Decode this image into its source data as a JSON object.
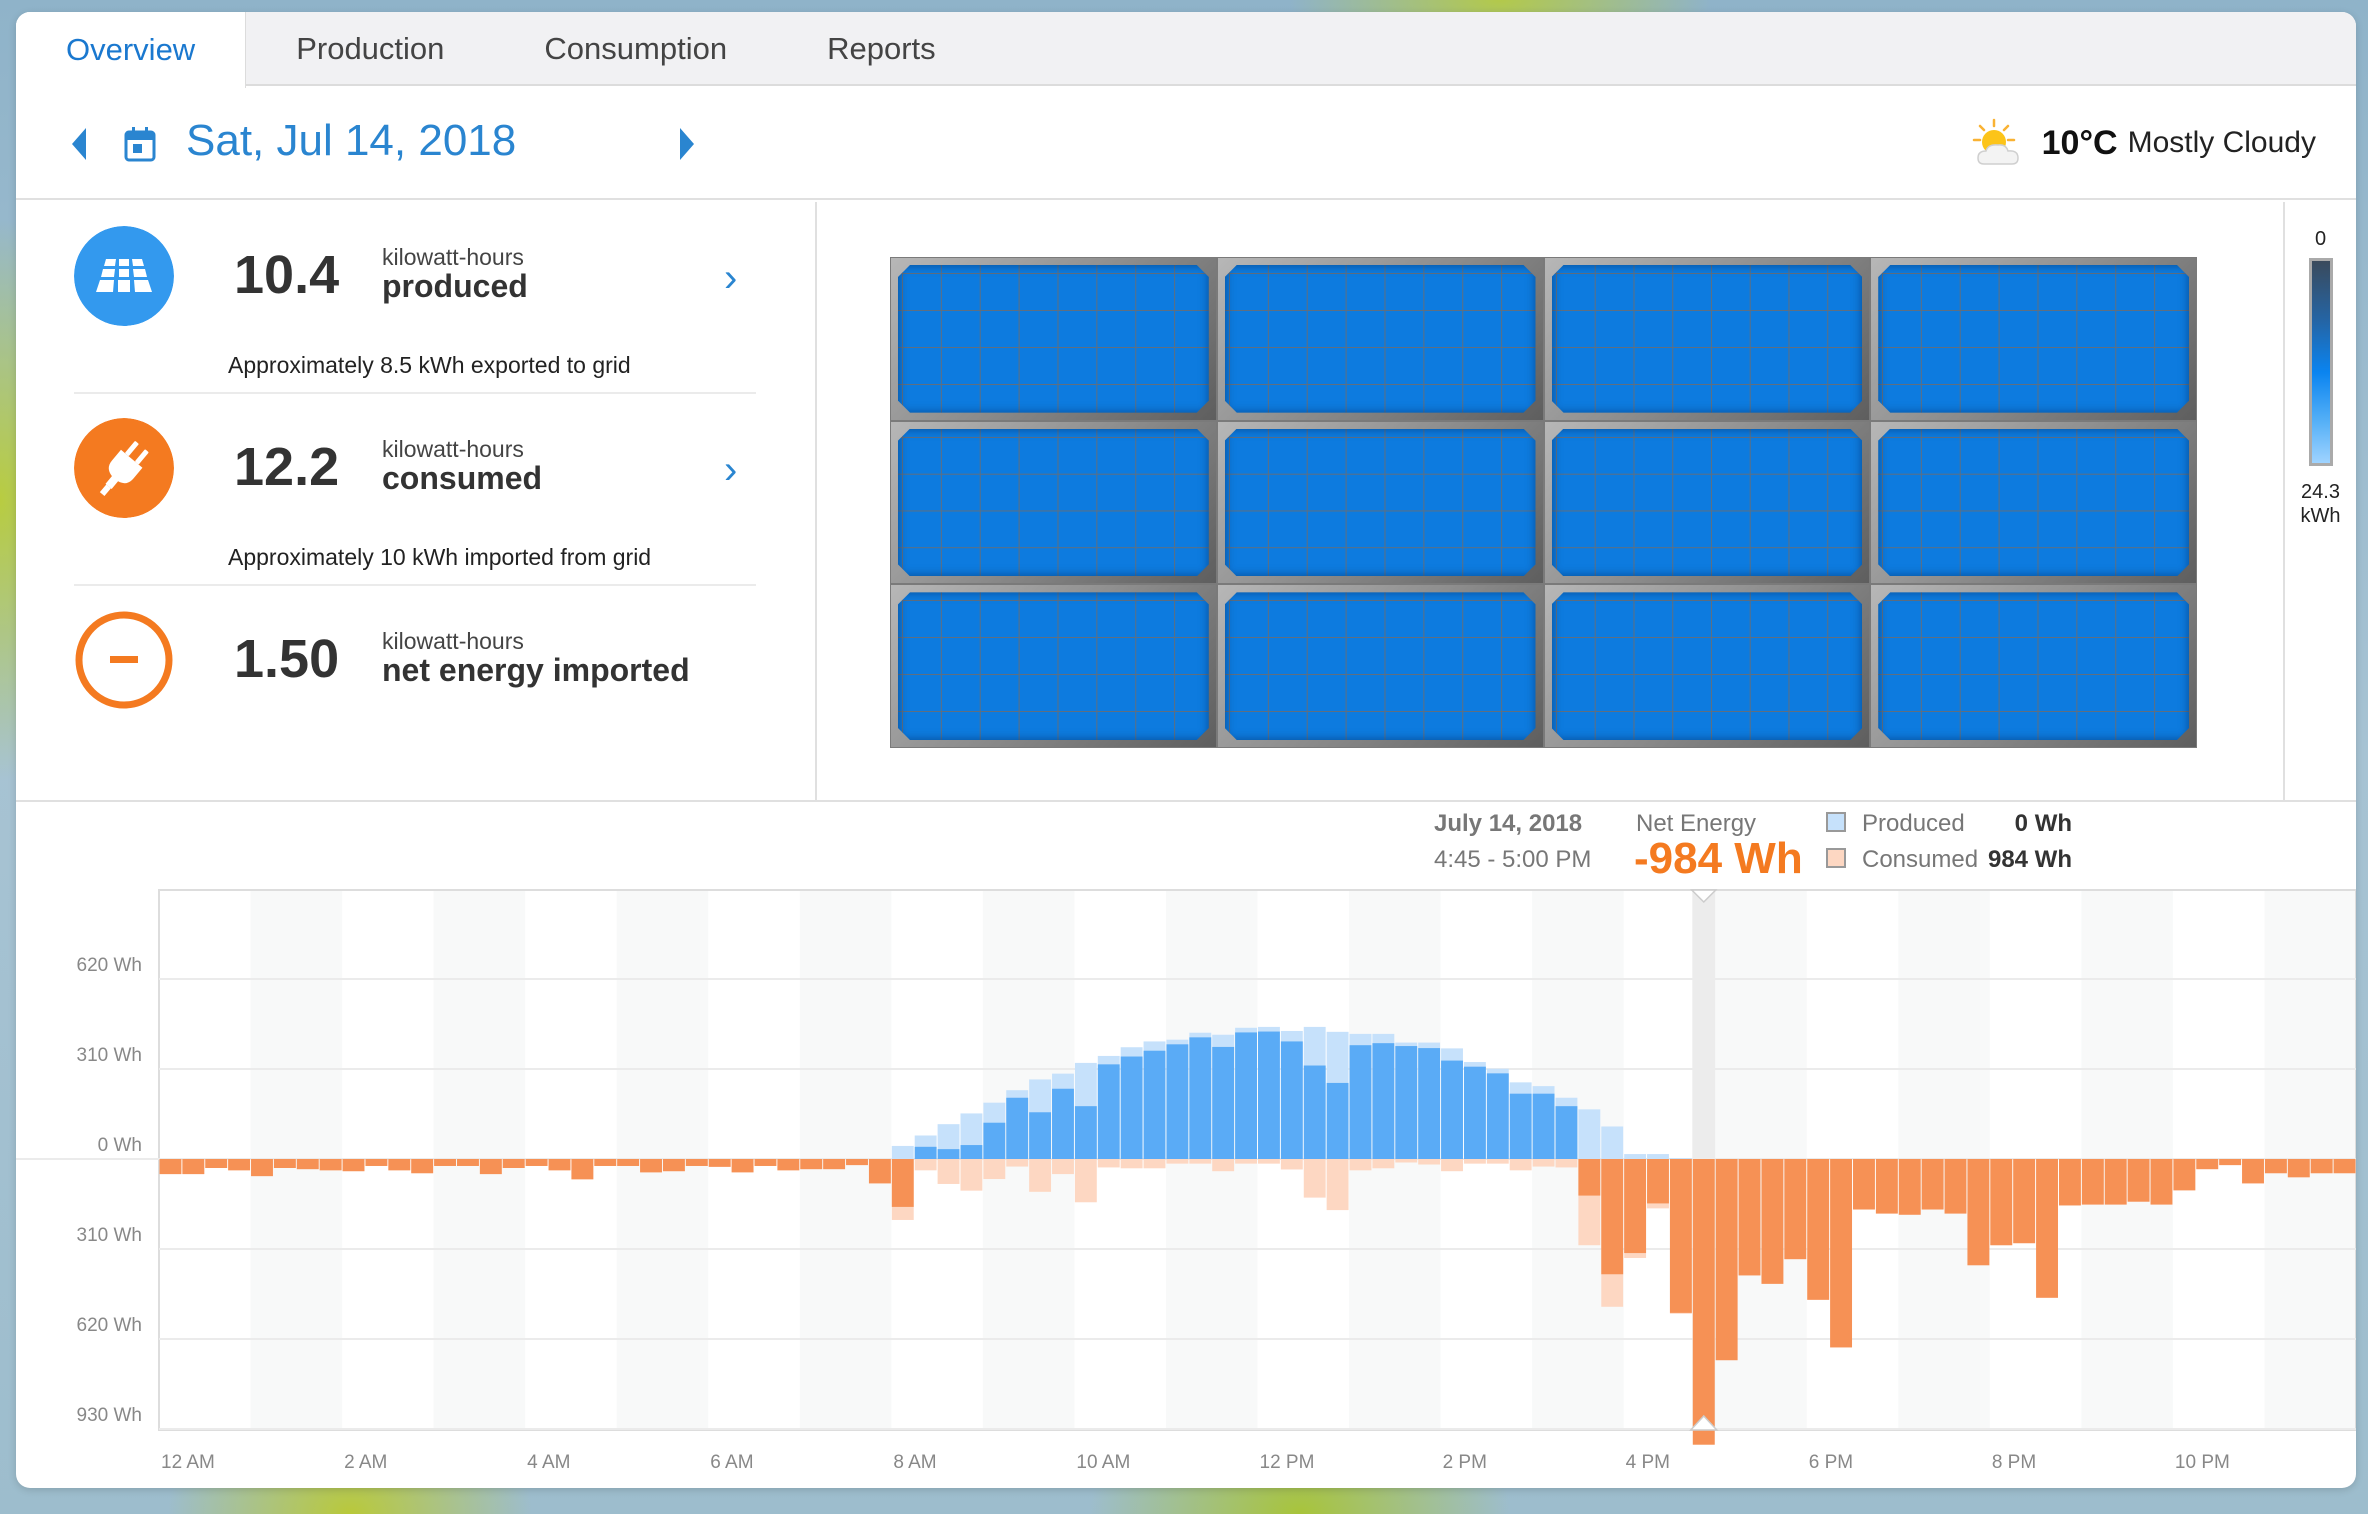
{
  "tabs": [
    {
      "label": "Overview",
      "active": true
    },
    {
      "label": "Production",
      "active": false
    },
    {
      "label": "Consumption",
      "active": false
    },
    {
      "label": "Reports",
      "active": false
    }
  ],
  "date_nav": {
    "date": "Sat, Jul 14, 2018",
    "prev_icon": "caret-left-icon",
    "next_icon": "caret-right-icon",
    "calendar_icon": "calendar-icon"
  },
  "weather": {
    "icon": "partly-cloudy-icon",
    "temperature": "10°C",
    "condition": "Mostly Cloudy"
  },
  "stats": [
    {
      "icon": "solar-panel-icon",
      "value": "10.4",
      "unit": "kilowatt-hours",
      "label": "produced",
      "note": "Approximately 8.5 kWh exported to grid",
      "color": "#3399ee",
      "has_chevron": true
    },
    {
      "icon": "plug-icon",
      "value": "12.2",
      "unit": "kilowatt-hours",
      "label": "consumed",
      "note": "Approximately 10 kWh imported from grid",
      "color": "#f47a20",
      "has_chevron": true
    },
    {
      "icon": "minus-circle-icon",
      "value": "1.50",
      "unit": "kilowatt-hours",
      "label": "net energy imported",
      "note": "",
      "color": "#f47a20",
      "has_chevron": false
    }
  ],
  "panel_array": {
    "rows": 3,
    "columns": 4,
    "legend_top": "0",
    "legend_bottom_value": "24.3",
    "legend_bottom_unit": "kWh"
  },
  "tooltip": {
    "date": "July 14, 2018",
    "time_range": "4:45 - 5:00 PM",
    "net_label": "Net Energy",
    "net_value": "-984 Wh",
    "produced_label": "Produced",
    "produced_value": "0 Wh",
    "consumed_label": "Consumed",
    "consumed_value": "984 Wh"
  },
  "colors": {
    "accent_blue": "#2a85d0",
    "produced_dark": "#5aabf6",
    "produced_light": "#c6e1fb",
    "consumed_dark": "#f69155",
    "consumed_light": "#fdd7c2",
    "orange": "#f47a20"
  },
  "chart_data": {
    "type": "bar",
    "title": "",
    "xlabel": "",
    "ylabel": "",
    "interval_minutes": 15,
    "x_tick_labels": [
      "12 AM",
      "2 AM",
      "4 AM",
      "6 AM",
      "8 AM",
      "10 AM",
      "12 PM",
      "2 PM",
      "4 PM",
      "6 PM",
      "8 PM",
      "10 PM"
    ],
    "y_tick_labels": [
      "620 Wh",
      "310 Wh",
      "0 Wh",
      "310 Wh",
      "620 Wh",
      "930 Wh"
    ],
    "y_tick_values": [
      620,
      310,
      0,
      -310,
      -620,
      -930
    ],
    "ylim": [
      -930,
      810
    ],
    "grid": true,
    "selected_index": 67,
    "series": [
      {
        "name": "Produced",
        "unit": "Wh",
        "values": [
          0,
          0,
          0,
          0,
          0,
          0,
          0,
          0,
          0,
          0,
          0,
          0,
          0,
          0,
          0,
          0,
          0,
          0,
          0,
          0,
          0,
          0,
          0,
          0,
          0,
          0,
          0,
          0,
          0,
          0,
          0,
          0,
          45,
          81,
          120,
          157,
          194,
          237,
          274,
          294,
          331,
          355,
          385,
          405,
          411,
          435,
          428,
          452,
          455,
          441,
          455,
          438,
          431,
          431,
          401,
          401,
          381,
          334,
          311,
          264,
          251,
          211,
          171,
          112,
          17,
          17,
          3,
          0,
          0,
          0,
          0,
          0,
          0,
          0,
          0,
          0,
          0,
          0,
          0,
          0,
          0,
          0,
          0,
          0,
          0,
          0,
          0,
          0,
          0,
          0,
          0,
          0,
          0,
          0,
          0,
          0
        ]
      },
      {
        "name": "Consumed",
        "unit": "Wh",
        "values": [
          52,
          52,
          31,
          39,
          59,
          31,
          35,
          39,
          42,
          24,
          39,
          49,
          24,
          24,
          52,
          31,
          24,
          39,
          70,
          24,
          24,
          46,
          42,
          24,
          27,
          46,
          24,
          39,
          35,
          35,
          21,
          84,
          210,
          39,
          86,
          109,
          69,
          26,
          113,
          52,
          149,
          29,
          32,
          32,
          16,
          16,
          42,
          16,
          16,
          36,
          133,
          176,
          39,
          32,
          12,
          19,
          42,
          16,
          16,
          39,
          26,
          29,
          297,
          509,
          341,
          170,
          533,
          984,
          693,
          401,
          430,
          345,
          485,
          649,
          174,
          188,
          192,
          174,
          188,
          366,
          297,
          290,
          478,
          160,
          157,
          157,
          147,
          157,
          108,
          35,
          21,
          84,
          49,
          63,
          49,
          49
        ]
      }
    ]
  }
}
